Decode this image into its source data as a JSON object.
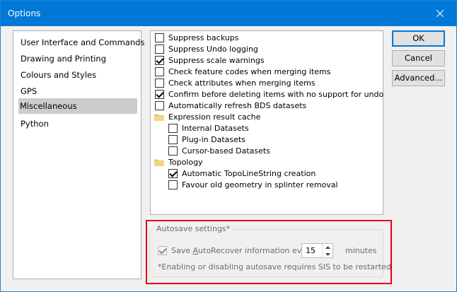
{
  "window": {
    "title": "Options"
  },
  "nav": {
    "items": [
      {
        "label": "User Interface and Commands",
        "selected": false
      },
      {
        "label": "Drawing and Printing",
        "selected": false
      },
      {
        "label": "Colours and Styles",
        "selected": false
      },
      {
        "label": "GPS",
        "selected": false
      },
      {
        "label": "Miscellaneous",
        "selected": true
      },
      {
        "label": "Python",
        "selected": false
      }
    ]
  },
  "options": {
    "items": [
      {
        "label": "Suppress backups",
        "checked": false
      },
      {
        "label": "Suppress Undo logging",
        "checked": false
      },
      {
        "label": "Suppress scale warnings",
        "checked": true
      },
      {
        "label": "Check feature codes when merging items",
        "checked": false
      },
      {
        "label": "Check attributes when merging items",
        "checked": false
      },
      {
        "label": "Confirm before deleting items with no support for undo",
        "checked": true
      },
      {
        "label": "Automatically refresh BDS datasets",
        "checked": false
      }
    ],
    "group_expression": {
      "label": "Expression result cache",
      "icon": "folder-icon",
      "items": [
        {
          "label": "Internal Datasets",
          "checked": false
        },
        {
          "label": "Plug-in Datasets",
          "checked": false
        },
        {
          "label": "Cursor-based Datasets",
          "checked": false
        }
      ]
    },
    "group_topology": {
      "label": "Topology",
      "icon": "folder-icon",
      "items": [
        {
          "label": "Automatic TopoLineString creation",
          "checked": true
        },
        {
          "label": "Favour old geometry in splinter removal",
          "checked": false
        }
      ]
    }
  },
  "buttons": {
    "ok": "OK",
    "cancel": "Cancel",
    "advanced": "Advanced..."
  },
  "autosave": {
    "title": "Autosave settings*",
    "checkbox_prefix": "Save ",
    "checkbox_underlined": "A",
    "checkbox_rest": "utoRecover information every",
    "checked": true,
    "minutes_value": "15",
    "minutes_label": "minutes",
    "note": "*Enabling or disabling autosave requires SIS to be restarted"
  },
  "colors": {
    "titlebar": "#0078d7",
    "selection": "#cccccc",
    "highlight_border": "#e3001b"
  }
}
